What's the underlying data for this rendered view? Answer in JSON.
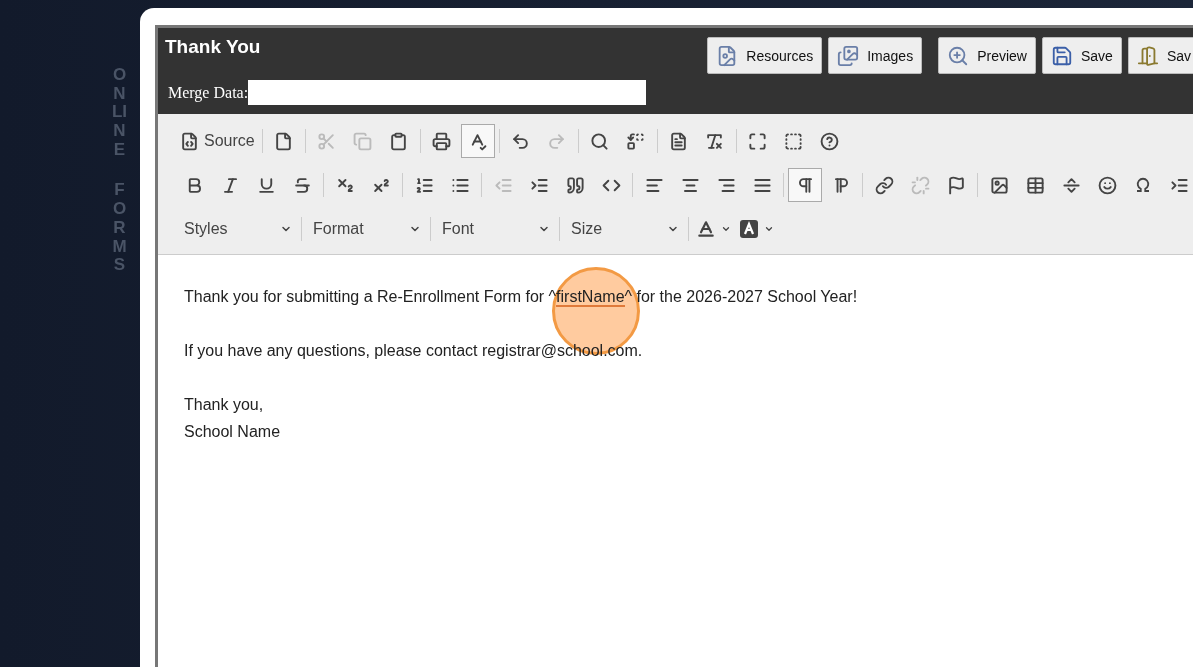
{
  "sidebar": {
    "vertical_words": [
      "ONLINE",
      "FORMS"
    ]
  },
  "header": {
    "title": "Thank You",
    "buttons": [
      {
        "label": "Resources"
      },
      {
        "label": "Images"
      },
      {
        "label": "Preview"
      },
      {
        "label": "Save"
      },
      {
        "label": "Sav"
      }
    ],
    "merge_data": {
      "label": "Merge Data:"
    }
  },
  "toolbar": {
    "rows": [
      {
        "groups": [
          {
            "buttons": [
              {
                "label": "Source",
                "disabled": false,
                "active": false
              }
            ]
          },
          {
            "buttons": [
              {
                "disabled": false,
                "active": false
              }
            ]
          },
          {
            "buttons": [
              {
                "disabled": true,
                "active": false
              },
              {
                "disabled": true,
                "active": false
              },
              {
                "disabled": false,
                "active": false
              }
            ]
          },
          {
            "buttons": [
              {
                "disabled": false,
                "active": false
              },
              {
                "disabled": false,
                "active": true
              }
            ]
          },
          {
            "buttons": [
              {
                "disabled": false,
                "active": false
              },
              {
                "disabled": true,
                "active": false
              }
            ]
          },
          {
            "buttons": [
              {
                "disabled": false,
                "active": false
              },
              {
                "disabled": false,
                "active": false
              }
            ]
          },
          {
            "buttons": [
              {
                "disabled": false,
                "active": false
              },
              {
                "disabled": false,
                "active": false
              }
            ]
          },
          {
            "buttons": [
              {
                "disabled": false,
                "active": false
              },
              {
                "disabled": false,
                "active": false
              },
              {
                "disabled": false,
                "active": false
              }
            ]
          }
        ]
      },
      {
        "groups": [
          {
            "buttons": [
              {
                "disabled": false,
                "active": false
              },
              {
                "disabled": false,
                "active": false
              },
              {
                "disabled": false,
                "active": false
              },
              {
                "disabled": false,
                "active": false
              }
            ]
          },
          {
            "buttons": [
              {
                "disabled": false,
                "active": false
              },
              {
                "disabled": false,
                "active": false
              }
            ]
          },
          {
            "buttons": [
              {
                "disabled": false,
                "active": false
              },
              {
                "disabled": false,
                "active": false
              }
            ]
          },
          {
            "buttons": [
              {
                "disabled": true,
                "active": false
              },
              {
                "disabled": false,
                "active": false
              },
              {
                "disabled": false,
                "active": false
              },
              {
                "disabled": false,
                "active": false
              }
            ]
          },
          {
            "buttons": [
              {
                "disabled": false,
                "active": false
              },
              {
                "disabled": false,
                "active": false
              },
              {
                "disabled": false,
                "active": false
              },
              {
                "disabled": false,
                "active": false
              }
            ]
          },
          {
            "buttons": [
              {
                "disabled": false,
                "active": true
              },
              {
                "disabled": false,
                "active": false
              }
            ]
          },
          {
            "buttons": [
              {
                "disabled": false,
                "active": false
              },
              {
                "disabled": true,
                "active": false
              },
              {
                "disabled": false,
                "active": false
              }
            ]
          },
          {
            "buttons": [
              {
                "disabled": false,
                "active": false
              },
              {
                "disabled": false,
                "active": false
              },
              {
                "disabled": false,
                "active": false
              },
              {
                "disabled": false,
                "active": false
              },
              {
                "disabled": false,
                "active": false
              },
              {
                "disabled": false,
                "active": false
              }
            ]
          }
        ]
      }
    ],
    "combos": [
      {
        "label": "Styles"
      },
      {
        "label": "Format"
      },
      {
        "label": "Font"
      },
      {
        "label": "Size"
      }
    ],
    "color_buttons": [
      {
        "disabled": false
      },
      {
        "disabled": false
      }
    ]
  },
  "content": {
    "paragraphs": [
      {
        "lines": [
          [
            {
              "text": "Thank you for submitting a Re-Enrollment Form for ^"
            },
            {
              "text": "firstName",
              "underlined": true
            },
            {
              "text": "^ for the 2026-2027 School Year!"
            }
          ]
        ]
      },
      {
        "lines": [
          [
            {
              "text": "If you have any questions, please contact registrar@school.com."
            }
          ]
        ]
      },
      {
        "lines": [
          [
            {
              "text": "Thank you,"
            }
          ],
          [
            {
              "text": "School Name"
            }
          ]
        ]
      }
    ]
  },
  "click_marker": {
    "shown": true
  }
}
